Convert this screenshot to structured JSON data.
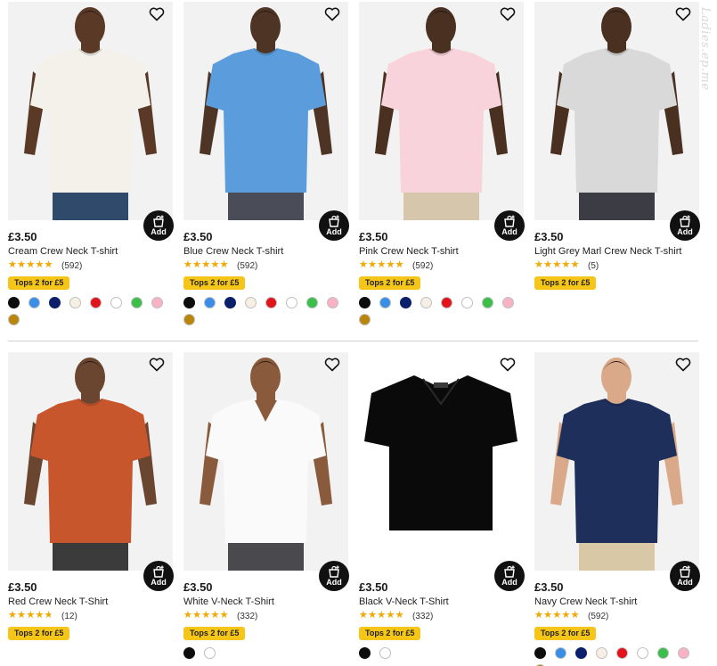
{
  "watermark": "Ladies.ep.me",
  "promo_label": "Tops 2 for £5",
  "add_label": "Add",
  "colors": {
    "black": "#0d0d0d",
    "blue": "#3a8ee6",
    "navy": "#0b1f6b",
    "cream": "#f7efe3",
    "red": "#e0141a",
    "white": "#ffffff",
    "green": "#3bbf4a",
    "pink": "#f7b3c4",
    "mustard": "#b8860b"
  },
  "products": [
    {
      "price": "£3.50",
      "name": "Cream Crew Neck T-shirt",
      "rating": 4.7,
      "reviews": "(592)",
      "shirt": "#f3f1ea",
      "skin": "#5a3a26",
      "bottom": "#2f4a6b",
      "style": "crew",
      "swatches": [
        "black",
        "blue",
        "navy",
        "cream",
        "red",
        "white",
        "green",
        "pink",
        "mustard"
      ]
    },
    {
      "price": "£3.50",
      "name": "Blue Crew Neck T-shirt",
      "rating": 4.6,
      "reviews": "(592)",
      "shirt": "#5b9ddc",
      "skin": "#4e3424",
      "bottom": "#4a4d57",
      "style": "crew",
      "swatches": [
        "black",
        "blue",
        "navy",
        "cream",
        "red",
        "white",
        "green",
        "pink",
        "mustard"
      ]
    },
    {
      "price": "£3.50",
      "name": "Pink Crew Neck T-shirt",
      "rating": 4.6,
      "reviews": "(592)",
      "shirt": "#f9d3dc",
      "skin": "#4a3020",
      "bottom": "#d6c7ac",
      "style": "crew",
      "swatches": [
        "black",
        "blue",
        "navy",
        "cream",
        "red",
        "white",
        "green",
        "pink",
        "mustard"
      ]
    },
    {
      "price": "£3.50",
      "name": "Light Grey Marl Crew Neck T-shirt",
      "rating": 5,
      "reviews": "(5)",
      "shirt": "#d9d9d9",
      "skin": "#4a3020",
      "bottom": "#3c3c44",
      "style": "crew",
      "swatches": []
    },
    {
      "price": "£3.50",
      "name": "Red Crew Neck T-Shirt",
      "rating": 4.3,
      "reviews": "(12)",
      "shirt": "#c8562c",
      "skin": "#6a4530",
      "bottom": "#3b3b3b",
      "style": "crew",
      "swatches": []
    },
    {
      "price": "£3.50",
      "name": "White V-Neck T-Shirt",
      "rating": 4.6,
      "reviews": "(332)",
      "shirt": "#fafafa",
      "skin": "#8a5a3c",
      "bottom": "#4a4a4e",
      "style": "vneck",
      "swatches": [
        "black",
        "white"
      ]
    },
    {
      "price": "£3.50",
      "name": "Black V-Neck T-Shirt",
      "rating": 4.6,
      "reviews": "(332)",
      "shirt": "#0a0a0a",
      "skin": "",
      "bottom": "",
      "style": "flat",
      "swatches": [
        "black",
        "white"
      ]
    },
    {
      "price": "£3.50",
      "name": "Navy Crew Neck T-shirt",
      "rating": 4.7,
      "reviews": "(592)",
      "shirt": "#1f2f5c",
      "skin": "#d9a98a",
      "bottom": "#d9c8a5",
      "style": "crew",
      "swatches": [
        "black",
        "blue",
        "navy",
        "cream",
        "red",
        "white",
        "green",
        "pink",
        "mustard"
      ]
    }
  ]
}
